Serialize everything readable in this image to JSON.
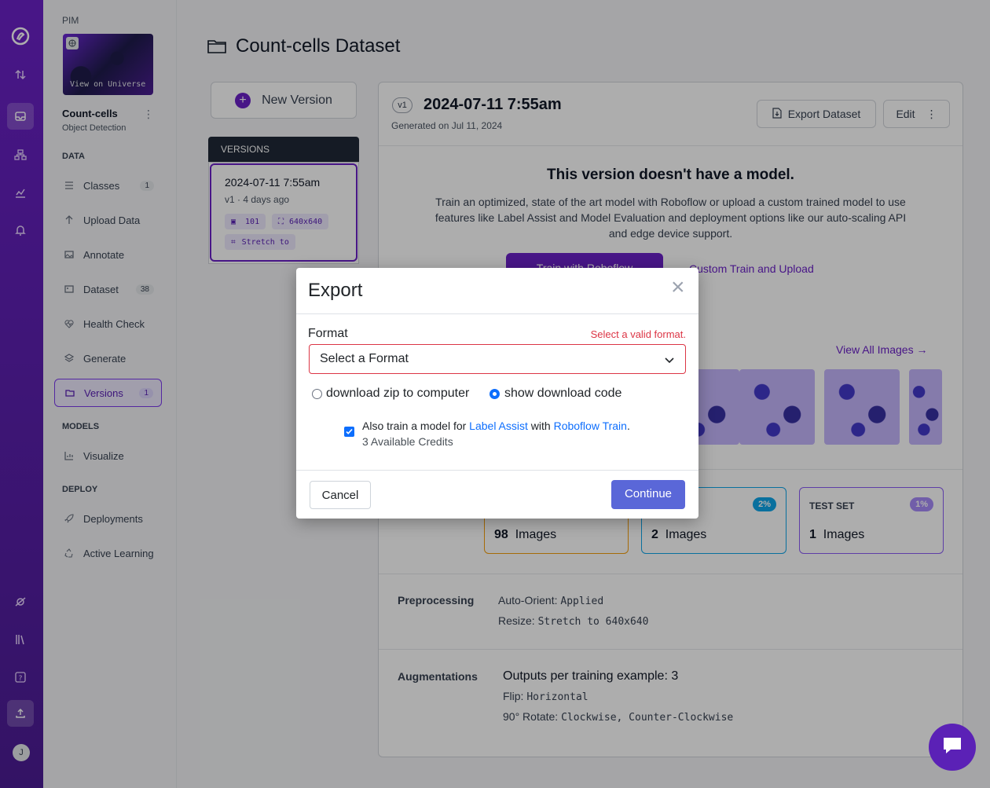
{
  "rail": {
    "user_initial": "J"
  },
  "sidebar": {
    "workspace": "PIM",
    "view_on_universe": "View on Universe",
    "project_name": "Count-cells",
    "project_type": "Object Detection",
    "sections": {
      "data": "DATA",
      "models": "MODELS",
      "deploy": "DEPLOY"
    },
    "items": [
      {
        "label": "Classes",
        "count": "1"
      },
      {
        "label": "Upload Data",
        "count": ""
      },
      {
        "label": "Annotate",
        "count": ""
      },
      {
        "label": "Dataset",
        "count": "38"
      },
      {
        "label": "Health Check",
        "count": ""
      },
      {
        "label": "Generate",
        "count": ""
      },
      {
        "label": "Versions",
        "count": "1"
      },
      {
        "label": "Visualize",
        "count": ""
      },
      {
        "label": "Deployments",
        "count": ""
      },
      {
        "label": "Active Learning",
        "count": ""
      }
    ]
  },
  "main": {
    "title": "Count-cells Dataset",
    "new_version": "New Version",
    "versions_header": "VERSIONS",
    "version_card": {
      "date": "2024-07-11 7:55am",
      "meta": "v1 · 4 days ago",
      "images": "101",
      "size": "640x640",
      "transform": "Stretch to"
    },
    "version": {
      "badge": "v1",
      "title": "2024-07-11 7:55am",
      "generated": "Generated on Jul 11, 2024",
      "export_btn": "Export Dataset",
      "edit_btn": "Edit"
    },
    "no_model": {
      "title": "This version doesn't have a model.",
      "desc": "Train an optimized, state of the art model with Roboflow or upload a custom trained model to use features like Label Assist and Model Evaluation and deployment options like our auto-scaling API and edge device support.",
      "train_btn": "Train with Roboflow",
      "custom_link": "Custom Train and Upload"
    },
    "view_all": "View All Images",
    "splits": [
      {
        "label": "",
        "pct": "",
        "count": "98",
        "unit": "Images"
      },
      {
        "label": "",
        "pct": "2%",
        "count": "2",
        "unit": "Images"
      },
      {
        "label": "TEST SET",
        "pct": "1%",
        "count": "1",
        "unit": "Images"
      }
    ],
    "preprocessing": {
      "label": "Preprocessing",
      "orient_key": "Auto-Orient:",
      "orient_val": "Applied",
      "resize_key": "Resize:",
      "resize_val": "Stretch to 640x640"
    },
    "augmentations": {
      "label": "Augmentations",
      "outputs": "Outputs per training example: 3",
      "flip_key": "Flip:",
      "flip_val": "Horizontal",
      "rotate_key": "90° Rotate:",
      "rotate_val": "Clockwise, Counter-Clockwise"
    }
  },
  "modal": {
    "title": "Export",
    "format_label": "Format",
    "format_error": "Select a valid format.",
    "format_placeholder": "Select a Format",
    "radio_zip": "download zip to computer",
    "radio_code": "show download code",
    "train_pre": "Also train a model for ",
    "train_link1": "Label Assist",
    "train_mid": " with ",
    "train_link2": "Roboflow Train",
    "train_post": ".",
    "credits": "3 Available Credits",
    "cancel": "Cancel",
    "continue": "Continue"
  },
  "colors": {
    "brand": "#6b21c8",
    "accent": "#7c3aed",
    "error": "#dc3545",
    "link": "#0d6efd",
    "continue": "#5a67d8"
  }
}
